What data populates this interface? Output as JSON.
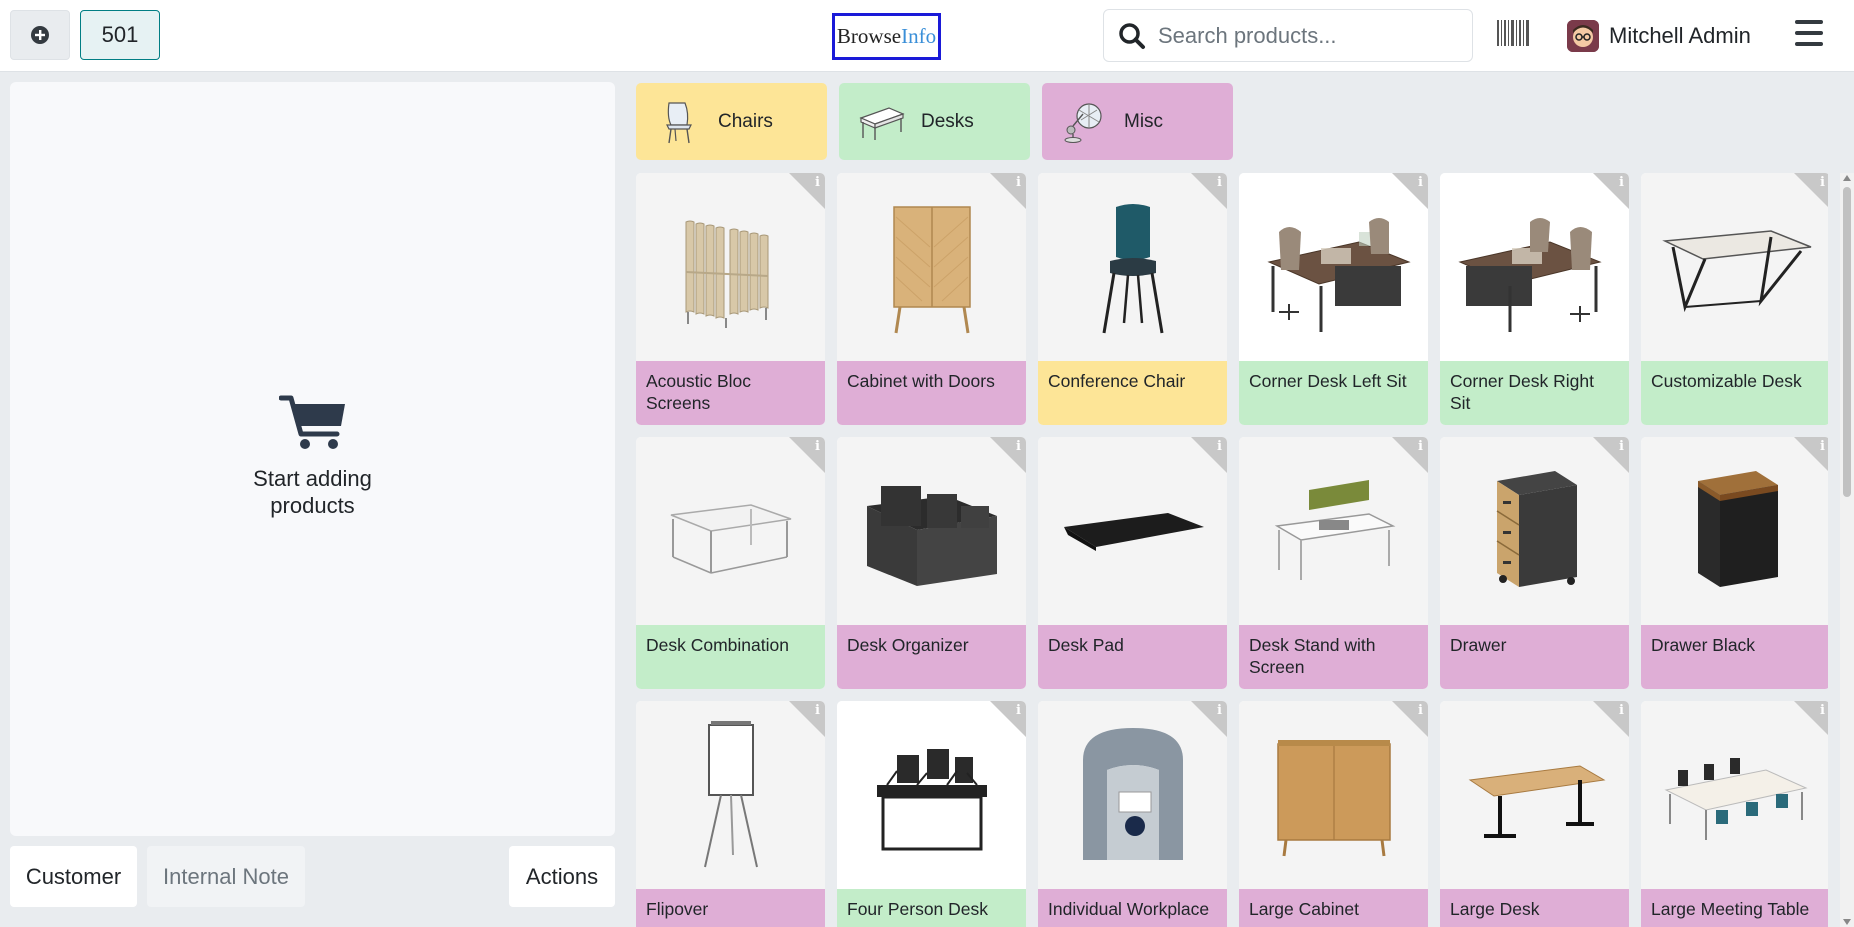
{
  "topbar": {
    "order_number": "501",
    "logo_text_main": "Browse",
    "logo_text_accent": "Info",
    "search_placeholder": "Search products...",
    "user_name": "Mitchell Admin"
  },
  "order_panel": {
    "empty_text_line1": "Start adding",
    "empty_text_line2": "products"
  },
  "bottom_buttons": {
    "customer": "Customer",
    "internal_note": "Internal Note",
    "actions": "Actions"
  },
  "categories": [
    {
      "label": "Chairs",
      "color": "#fde597"
    },
    {
      "label": "Desks",
      "color": "#c3edc9"
    },
    {
      "label": "Misc",
      "color": "#dfaed6"
    }
  ],
  "products": [
    {
      "name": "Acoustic Bloc Screens",
      "category": "misc"
    },
    {
      "name": "Cabinet with Doors",
      "category": "misc"
    },
    {
      "name": "Conference Chair",
      "category": "chairs"
    },
    {
      "name": "Corner Desk Left Sit",
      "category": "desks"
    },
    {
      "name": "Corner Desk Right Sit",
      "category": "desks"
    },
    {
      "name": "Customizable Desk",
      "category": "desks"
    },
    {
      "name": "Desk Combination",
      "category": "desks"
    },
    {
      "name": "Desk Organizer",
      "category": "misc"
    },
    {
      "name": "Desk Pad",
      "category": "misc"
    },
    {
      "name": "Desk Stand with Screen",
      "category": "misc"
    },
    {
      "name": "Drawer",
      "category": "misc"
    },
    {
      "name": "Drawer Black",
      "category": "misc"
    },
    {
      "name": "Flipover",
      "category": "misc"
    },
    {
      "name": "Four Person Desk",
      "category": "desks"
    },
    {
      "name": "Individual Workplace",
      "category": "misc"
    },
    {
      "name": "Large Cabinet",
      "category": "misc"
    },
    {
      "name": "Large Desk",
      "category": "misc"
    },
    {
      "name": "Large Meeting Table",
      "category": "misc"
    }
  ],
  "info_glyph": "i"
}
